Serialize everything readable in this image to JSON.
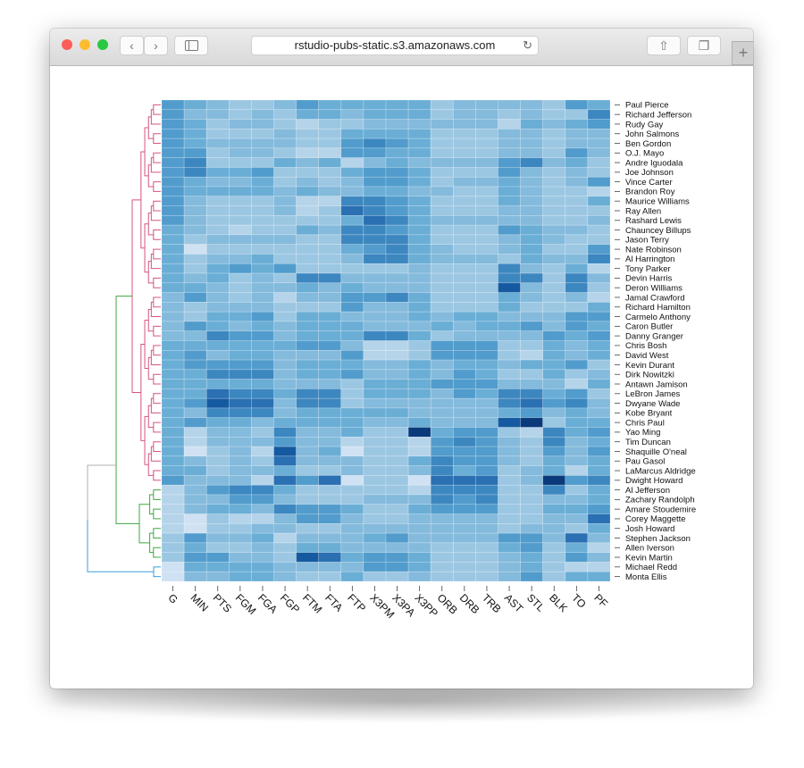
{
  "browser": {
    "url": "rstudio-pubs-static.s3.amazonaws.com",
    "back_icon": "chevron-left-icon",
    "forward_icon": "chevron-right-icon",
    "sidebar_icon": "sidebar-icon",
    "reload_icon": "reload-icon",
    "share_icon": "share-icon",
    "tabs_icon": "tabs-icon",
    "new_tab_label": "+"
  },
  "chart_data": {
    "type": "heatmap",
    "color_scale": "Blues (light = low, dark = high)",
    "dendrogram": "rows",
    "cluster_colors": [
      "#d6547f",
      "#3fa83f",
      "#3a9ee0",
      "#b0b0b0"
    ],
    "columns": [
      "G",
      "MIN",
      "PTS",
      "FGM",
      "FGA",
      "FGP",
      "FTM",
      "FTA",
      "FTP",
      "X3PM",
      "X3PA",
      "X3PP",
      "ORB",
      "DRB",
      "TRB",
      "AST",
      "STL",
      "BLK",
      "TO",
      "PF"
    ],
    "rows": [
      "Paul Pierce",
      "Richard Jefferson",
      "Rudy Gay",
      "John Salmons",
      "Ben Gordon",
      "O.J. Mayo",
      "Andre Iguodala",
      "Joe Johnson",
      "Vince Carter",
      "Brandon Roy",
      "Maurice Williams",
      "Ray Allen",
      "Rashard Lewis",
      "Chauncey Billups",
      "Jason Terry",
      "Nate Robinson",
      "Al Harrington",
      "Tony Parker",
      "Devin Harris",
      "Deron Williams",
      "Jamal Crawford",
      "Richard Hamilton",
      "Carmelo Anthony",
      "Caron Butler",
      "Danny Granger",
      "Chris Bosh",
      "David West",
      "Kevin Durant",
      "Dirk Nowitzki",
      "Antawn Jamison",
      "LeBron James",
      "Dwyane Wade",
      "Kobe Bryant",
      "Chris Paul",
      "Yao Ming",
      "Tim Duncan",
      "Shaquille O'neal",
      "Pau Gasol",
      "LaMarcus Aldridge",
      "Dwight Howard",
      "Al Jefferson",
      "Zachary Randolph",
      "Amare Stoudemire",
      "Corey Maggette",
      "Josh Howard",
      "Stephen Jackson",
      "Allen Iverson",
      "Kevin Martin",
      "Michael Redd",
      "Monta Ellis"
    ],
    "value_range": [
      0,
      10
    ],
    "values": [
      [
        6,
        5,
        4,
        3,
        3,
        4,
        6,
        5,
        5,
        5,
        5,
        5,
        3,
        4,
        4,
        4,
        4,
        3,
        6,
        5
      ],
      [
        6,
        4,
        4,
        3,
        4,
        3,
        5,
        5,
        4,
        5,
        5,
        5,
        3,
        4,
        4,
        3,
        4,
        3,
        3,
        7
      ],
      [
        6,
        5,
        3,
        4,
        4,
        3,
        2,
        3,
        3,
        4,
        4,
        4,
        4,
        4,
        4,
        2,
        5,
        4,
        5,
        6
      ],
      [
        6,
        5,
        3,
        3,
        3,
        4,
        3,
        3,
        5,
        5,
        5,
        5,
        3,
        3,
        3,
        4,
        4,
        3,
        4,
        4
      ],
      [
        6,
        5,
        4,
        4,
        4,
        4,
        3,
        3,
        6,
        7,
        6,
        5,
        3,
        3,
        3,
        4,
        4,
        3,
        4,
        4
      ],
      [
        6,
        6,
        3,
        4,
        4,
        3,
        2,
        2,
        6,
        6,
        5,
        5,
        3,
        3,
        3,
        4,
        4,
        3,
        6,
        4
      ],
      [
        6,
        7,
        3,
        3,
        3,
        5,
        4,
        5,
        2,
        4,
        5,
        4,
        4,
        4,
        4,
        6,
        7,
        4,
        5,
        3
      ],
      [
        6,
        7,
        5,
        5,
        6,
        3,
        3,
        3,
        5,
        6,
        6,
        5,
        3,
        3,
        3,
        6,
        4,
        3,
        4,
        3
      ],
      [
        6,
        5,
        4,
        4,
        5,
        3,
        4,
        3,
        4,
        6,
        6,
        5,
        3,
        4,
        4,
        5,
        4,
        3,
        4,
        6
      ],
      [
        6,
        5,
        5,
        5,
        5,
        4,
        5,
        4,
        4,
        5,
        5,
        4,
        4,
        3,
        3,
        5,
        4,
        3,
        3,
        2
      ],
      [
        6,
        4,
        3,
        3,
        3,
        4,
        2,
        2,
        7,
        7,
        6,
        5,
        3,
        3,
        3,
        5,
        4,
        3,
        3,
        5
      ],
      [
        6,
        4,
        3,
        3,
        3,
        4,
        2,
        3,
        8,
        7,
        6,
        5,
        3,
        3,
        3,
        4,
        4,
        3,
        3,
        3
      ],
      [
        6,
        4,
        3,
        3,
        3,
        3,
        3,
        3,
        5,
        8,
        7,
        5,
        4,
        4,
        4,
        4,
        4,
        3,
        3,
        4
      ],
      [
        5,
        4,
        3,
        2,
        3,
        3,
        5,
        4,
        7,
        7,
        6,
        5,
        3,
        3,
        3,
        6,
        5,
        4,
        4,
        3
      ],
      [
        5,
        3,
        4,
        4,
        4,
        4,
        3,
        3,
        7,
        7,
        7,
        5,
        3,
        3,
        3,
        4,
        5,
        4,
        3,
        3
      ],
      [
        5,
        1,
        3,
        3,
        3,
        3,
        3,
        3,
        5,
        6,
        7,
        5,
        4,
        3,
        3,
        4,
        5,
        3,
        3,
        6
      ],
      [
        5,
        3,
        4,
        4,
        5,
        3,
        3,
        3,
        4,
        7,
        7,
        5,
        4,
        4,
        4,
        3,
        5,
        4,
        4,
        7
      ],
      [
        5,
        3,
        5,
        6,
        5,
        6,
        3,
        3,
        3,
        3,
        3,
        4,
        3,
        3,
        3,
        7,
        4,
        3,
        5,
        2
      ],
      [
        5,
        4,
        5,
        3,
        4,
        3,
        7,
        7,
        4,
        4,
        4,
        4,
        3,
        3,
        3,
        7,
        7,
        3,
        7,
        4
      ],
      [
        5,
        5,
        4,
        3,
        4,
        4,
        5,
        4,
        5,
        4,
        4,
        4,
        3,
        3,
        3,
        9,
        4,
        3,
        7,
        3
      ],
      [
        4,
        6,
        4,
        3,
        4,
        2,
        4,
        4,
        6,
        6,
        7,
        5,
        3,
        3,
        3,
        5,
        4,
        3,
        4,
        2
      ],
      [
        4,
        3,
        4,
        4,
        4,
        3,
        3,
        3,
        6,
        4,
        4,
        5,
        3,
        3,
        3,
        5,
        3,
        3,
        3,
        5
      ],
      [
        4,
        3,
        5,
        5,
        6,
        3,
        5,
        5,
        4,
        4,
        4,
        5,
        4,
        5,
        5,
        4,
        4,
        4,
        6,
        6
      ],
      [
        4,
        6,
        5,
        4,
        5,
        4,
        5,
        5,
        5,
        4,
        4,
        4,
        5,
        4,
        5,
        5,
        6,
        4,
        6,
        5
      ],
      [
        4,
        4,
        7,
        6,
        6,
        4,
        5,
        5,
        5,
        7,
        7,
        5,
        3,
        4,
        4,
        4,
        4,
        6,
        5,
        6
      ],
      [
        5,
        5,
        5,
        5,
        5,
        5,
        6,
        6,
        4,
        2,
        2,
        3,
        6,
        6,
        6,
        3,
        3,
        5,
        4,
        5
      ],
      [
        5,
        6,
        4,
        5,
        5,
        4,
        4,
        4,
        6,
        2,
        2,
        3,
        6,
        6,
        6,
        3,
        2,
        5,
        4,
        5
      ],
      [
        5,
        6,
        6,
        6,
        6,
        4,
        5,
        5,
        5,
        4,
        4,
        5,
        4,
        5,
        5,
        4,
        5,
        5,
        6,
        3
      ],
      [
        5,
        5,
        7,
        7,
        7,
        4,
        5,
        5,
        6,
        4,
        4,
        5,
        4,
        6,
        5,
        3,
        3,
        5,
        3,
        4
      ],
      [
        5,
        5,
        5,
        5,
        5,
        4,
        4,
        4,
        3,
        5,
        5,
        5,
        6,
        6,
        6,
        4,
        4,
        4,
        2,
        5
      ],
      [
        5,
        5,
        8,
        7,
        7,
        5,
        7,
        7,
        3,
        5,
        5,
        5,
        4,
        6,
        5,
        7,
        7,
        5,
        6,
        3
      ],
      [
        5,
        6,
        9,
        8,
        8,
        4,
        7,
        7,
        3,
        4,
        4,
        4,
        4,
        4,
        4,
        7,
        8,
        6,
        7,
        4
      ],
      [
        5,
        4,
        7,
        7,
        7,
        4,
        5,
        5,
        5,
        5,
        5,
        4,
        4,
        4,
        4,
        5,
        6,
        4,
        5,
        4
      ],
      [
        5,
        6,
        5,
        5,
        4,
        5,
        5,
        5,
        5,
        4,
        4,
        5,
        4,
        4,
        4,
        9,
        10,
        3,
        5,
        5
      ],
      [
        5,
        2,
        4,
        4,
        3,
        7,
        4,
        4,
        5,
        3,
        3,
        10,
        5,
        6,
        6,
        3,
        2,
        7,
        5,
        6
      ],
      [
        5,
        2,
        4,
        4,
        4,
        6,
        4,
        4,
        2,
        3,
        3,
        2,
        6,
        7,
        6,
        4,
        3,
        7,
        4,
        5
      ],
      [
        5,
        1,
        3,
        4,
        2,
        9,
        4,
        5,
        1,
        3,
        3,
        2,
        6,
        6,
        6,
        4,
        3,
        6,
        4,
        6
      ],
      [
        5,
        4,
        3,
        4,
        3,
        8,
        4,
        4,
        4,
        3,
        3,
        5,
        7,
        6,
        6,
        4,
        3,
        5,
        4,
        5
      ],
      [
        5,
        5,
        3,
        4,
        4,
        5,
        3,
        3,
        4,
        3,
        3,
        4,
        7,
        5,
        6,
        3,
        4,
        5,
        2,
        5
      ],
      [
        6,
        4,
        4,
        4,
        2,
        8,
        6,
        8,
        1,
        3,
        3,
        1,
        8,
        8,
        8,
        3,
        4,
        10,
        6,
        7
      ],
      [
        2,
        4,
        6,
        7,
        7,
        5,
        3,
        3,
        3,
        3,
        3,
        2,
        7,
        7,
        7,
        3,
        3,
        7,
        3,
        5
      ],
      [
        2,
        4,
        4,
        6,
        6,
        4,
        3,
        3,
        3,
        4,
        4,
        4,
        7,
        6,
        7,
        3,
        3,
        4,
        4,
        5
      ],
      [
        2,
        4,
        5,
        5,
        4,
        7,
        6,
        6,
        5,
        3,
        3,
        5,
        6,
        6,
        6,
        3,
        3,
        5,
        5,
        6
      ],
      [
        2,
        1,
        3,
        2,
        2,
        4,
        6,
        6,
        4,
        3,
        3,
        4,
        4,
        4,
        4,
        3,
        3,
        4,
        4,
        8
      ],
      [
        2,
        1,
        3,
        3,
        4,
        4,
        3,
        3,
        4,
        4,
        4,
        4,
        4,
        4,
        4,
        3,
        4,
        4,
        3,
        5
      ],
      [
        3,
        6,
        4,
        4,
        5,
        2,
        4,
        4,
        4,
        5,
        6,
        4,
        4,
        4,
        4,
        6,
        6,
        4,
        8,
        4
      ],
      [
        3,
        5,
        3,
        3,
        4,
        3,
        5,
        5,
        4,
        4,
        4,
        4,
        3,
        3,
        3,
        5,
        6,
        3,
        5,
        2
      ],
      [
        3,
        6,
        6,
        4,
        4,
        3,
        9,
        8,
        5,
        6,
        6,
        5,
        3,
        3,
        3,
        4,
        5,
        3,
        6,
        4
      ],
      [
        1,
        5,
        5,
        5,
        5,
        4,
        4,
        4,
        4,
        6,
        6,
        5,
        3,
        3,
        3,
        4,
        5,
        3,
        2,
        2
      ],
      [
        1,
        4,
        4,
        5,
        5,
        4,
        3,
        3,
        5,
        3,
        3,
        4,
        3,
        3,
        3,
        4,
        6,
        3,
        5,
        5
      ]
    ]
  }
}
